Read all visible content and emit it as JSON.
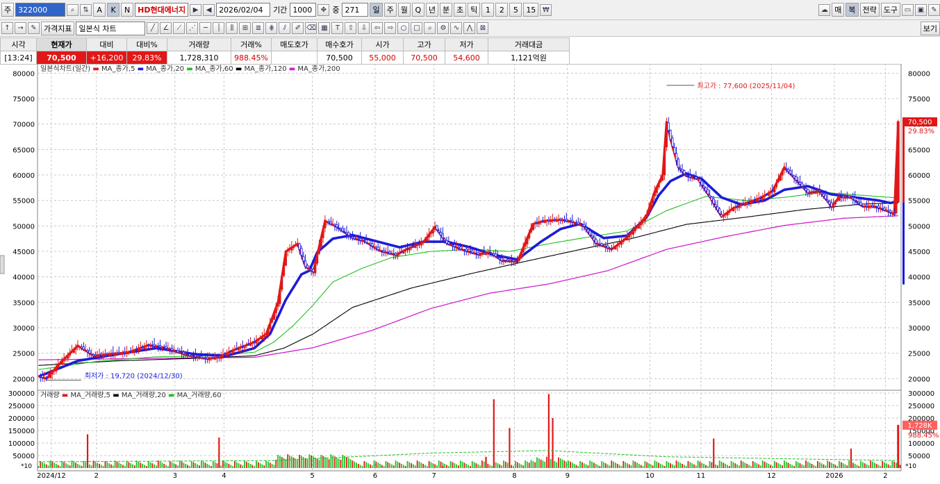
{
  "toolbar": {
    "code_prefix": "주",
    "code": "322000",
    "btn_a": "A",
    "btn_k": "K",
    "btn_n": "N",
    "stock_name": "HD현대에너지",
    "date": "2026/02/04",
    "period_label": "기간",
    "period_value": "1000",
    "jung_label": "중",
    "jung_value": "271",
    "periods": [
      "일",
      "주",
      "월",
      "Q",
      "년",
      "분",
      "초",
      "틱",
      "1",
      "2",
      "5",
      "15"
    ],
    "right_btns": [
      "매",
      "복",
      "전략",
      "도구"
    ]
  },
  "toolbar2": {
    "indicator_btn": "가격지표",
    "chart_type": "일본식 차트",
    "view_btn": "보기"
  },
  "quote": {
    "headers": [
      "시각",
      "현재가",
      "대비",
      "대비%",
      "거래량",
      "거래%",
      "매도호가",
      "매수호가",
      "시가",
      "고가",
      "저가",
      "거래대금"
    ],
    "values": [
      "[13:24]",
      "70,500",
      "+16,200",
      "29.83%",
      "1,728,310",
      "988.45%",
      "",
      "70,500",
      "55,000",
      "70,500",
      "54,600",
      "1,121억원"
    ]
  },
  "colors": {
    "candle_up": "#e01818",
    "candle_down": "#1818e0",
    "ma5": "#e01818",
    "ma20": "#1c1cd8",
    "ma60": "#20c020",
    "ma120": "#000000",
    "ma200": "#d020d0"
  },
  "chart_data": [
    {
      "type": "candlestick",
      "legend": "일본식차트(일간)",
      "legend_items": [
        "MA_종가,5",
        "MA_종가,20",
        "MA_종가,60",
        "MA_종가,120",
        "MA_종가,200"
      ],
      "ylim": [
        18000,
        81000
      ],
      "yticks": [
        20000,
        25000,
        30000,
        35000,
        40000,
        45000,
        50000,
        55000,
        60000,
        65000,
        70000,
        75000,
        80000
      ],
      "x_labels": [
        "2024/12",
        "2",
        "3",
        "4",
        "5",
        "6",
        "7",
        "8",
        "9",
        "10",
        "11",
        "12",
        "2026",
        "2"
      ],
      "close_series": [
        [
          0,
          20500
        ],
        [
          4,
          20000
        ],
        [
          12,
          23500
        ],
        [
          20,
          26500
        ],
        [
          28,
          24500
        ],
        [
          36,
          24800
        ],
        [
          46,
          25200
        ],
        [
          56,
          26600
        ],
        [
          64,
          26100
        ],
        [
          76,
          24600
        ],
        [
          86,
          23900
        ],
        [
          92,
          24200
        ],
        [
          98,
          25400
        ],
        [
          110,
          27200
        ],
        [
          116,
          28800
        ],
        [
          122,
          35000
        ],
        [
          126,
          45000
        ],
        [
          132,
          46500
        ],
        [
          136,
          42000
        ],
        [
          140,
          41000
        ],
        [
          146,
          51000
        ],
        [
          152,
          49800
        ],
        [
          160,
          47600
        ],
        [
          166,
          47000
        ],
        [
          174,
          45100
        ],
        [
          182,
          44300
        ],
        [
          188,
          45500
        ],
        [
          196,
          46800
        ],
        [
          202,
          49800
        ],
        [
          208,
          46600
        ],
        [
          216,
          45300
        ],
        [
          224,
          44400
        ],
        [
          230,
          44800
        ],
        [
          236,
          43200
        ],
        [
          244,
          43000
        ],
        [
          252,
          50400
        ],
        [
          258,
          51000
        ],
        [
          266,
          51200
        ],
        [
          272,
          50800
        ],
        [
          278,
          49900
        ],
        [
          284,
          46600
        ],
        [
          292,
          45400
        ],
        [
          300,
          47800
        ],
        [
          306,
          50200
        ],
        [
          310,
          52200
        ],
        [
          314,
          56800
        ],
        [
          318,
          60000
        ],
        [
          320,
          70500
        ],
        [
          322,
          67000
        ],
        [
          326,
          61500
        ],
        [
          330,
          59800
        ],
        [
          336,
          59200
        ],
        [
          342,
          55700
        ],
        [
          348,
          51800
        ],
        [
          354,
          53500
        ],
        [
          360,
          54400
        ],
        [
          368,
          55500
        ],
        [
          374,
          56900
        ],
        [
          380,
          61500
        ],
        [
          386,
          59000
        ],
        [
          392,
          56500
        ],
        [
          398,
          56800
        ],
        [
          404,
          53800
        ],
        [
          408,
          55700
        ],
        [
          414,
          55600
        ],
        [
          420,
          53800
        ],
        [
          426,
          53800
        ],
        [
          432,
          53000
        ],
        [
          436,
          52300
        ],
        [
          438,
          70500
        ]
      ],
      "ma20_series": [
        [
          0,
          20400
        ],
        [
          20,
          23500
        ],
        [
          40,
          24800
        ],
        [
          60,
          26000
        ],
        [
          80,
          24800
        ],
        [
          96,
          24500
        ],
        [
          110,
          26000
        ],
        [
          118,
          28800
        ],
        [
          126,
          35500
        ],
        [
          134,
          40500
        ],
        [
          138,
          41200
        ],
        [
          142,
          44800
        ],
        [
          150,
          47500
        ],
        [
          160,
          48200
        ],
        [
          172,
          47000
        ],
        [
          184,
          45800
        ],
        [
          196,
          46900
        ],
        [
          208,
          46900
        ],
        [
          220,
          45800
        ],
        [
          232,
          44300
        ],
        [
          244,
          43400
        ],
        [
          256,
          46900
        ],
        [
          266,
          49400
        ],
        [
          276,
          50400
        ],
        [
          288,
          47600
        ],
        [
          300,
          48100
        ],
        [
          310,
          51800
        ],
        [
          316,
          56000
        ],
        [
          322,
          58800
        ],
        [
          330,
          60300
        ],
        [
          338,
          59200
        ],
        [
          348,
          55600
        ],
        [
          358,
          54200
        ],
        [
          370,
          55000
        ],
        [
          380,
          57100
        ],
        [
          392,
          57800
        ],
        [
          404,
          56200
        ],
        [
          416,
          55600
        ],
        [
          428,
          55000
        ],
        [
          434,
          54500
        ],
        [
          438,
          54800
        ]
      ],
      "ma60_series": [
        [
          0,
          21800
        ],
        [
          30,
          23400
        ],
        [
          60,
          24300
        ],
        [
          90,
          24500
        ],
        [
          110,
          25200
        ],
        [
          120,
          27200
        ],
        [
          130,
          30500
        ],
        [
          140,
          34500
        ],
        [
          150,
          39000
        ],
        [
          165,
          41700
        ],
        [
          180,
          43800
        ],
        [
          200,
          45000
        ],
        [
          220,
          45400
        ],
        [
          240,
          45000
        ],
        [
          260,
          46500
        ],
        [
          280,
          47800
        ],
        [
          300,
          49000
        ],
        [
          320,
          53000
        ],
        [
          340,
          55800
        ],
        [
          360,
          55000
        ],
        [
          380,
          55600
        ],
        [
          400,
          56600
        ],
        [
          420,
          56000
        ],
        [
          438,
          55500
        ]
      ],
      "ma120_series": [
        [
          0,
          22600
        ],
        [
          40,
          23500
        ],
        [
          80,
          24000
        ],
        [
          110,
          24500
        ],
        [
          125,
          26000
        ],
        [
          140,
          28800
        ],
        [
          160,
          34000
        ],
        [
          190,
          37800
        ],
        [
          220,
          40600
        ],
        [
          250,
          43200
        ],
        [
          280,
          45700
        ],
        [
          300,
          47300
        ],
        [
          330,
          50300
        ],
        [
          360,
          51700
        ],
        [
          390,
          53200
        ],
        [
          420,
          54300
        ],
        [
          438,
          54500
        ]
      ],
      "ma200_series": [
        [
          0,
          23700
        ],
        [
          60,
          24000
        ],
        [
          110,
          24200
        ],
        [
          140,
          26100
        ],
        [
          170,
          29500
        ],
        [
          200,
          33800
        ],
        [
          230,
          36800
        ],
        [
          260,
          38600
        ],
        [
          290,
          41200
        ],
        [
          320,
          45400
        ],
        [
          350,
          47900
        ],
        [
          380,
          50100
        ],
        [
          410,
          51500
        ],
        [
          438,
          52000
        ]
      ],
      "annotations": {
        "high": "최고가 : 77,600 (2025/11/04)",
        "low": "최저가 : 19,720 (2024/12/30)"
      },
      "last_price_label": "70,500",
      "last_pct_label": "29.83%"
    },
    {
      "type": "bar",
      "legend": "거래량",
      "legend_items": [
        "MA_거래량,5",
        "MA_거래량,20",
        "MA_거래량,60"
      ],
      "ylim": [
        0,
        300000
      ],
      "yticks": [
        50000,
        100000,
        150000,
        200000,
        250000,
        300000
      ],
      "axis_unit": "10",
      "spikes": [
        [
          25,
          135000
        ],
        [
          92,
          122000
        ],
        [
          206,
          8000
        ],
        [
          228,
          45000
        ],
        [
          232,
          275000
        ],
        [
          240,
          160000
        ],
        [
          260,
          296000
        ],
        [
          262,
          200000
        ],
        [
          344,
          118000
        ],
        [
          414,
          78000
        ],
        [
          494,
          16000
        ],
        [
          543,
          14000
        ]
      ],
      "ma60_levels": [
        [
          0,
          25000
        ],
        [
          120,
          30000
        ],
        [
          200,
          60000
        ],
        [
          260,
          70000
        ],
        [
          320,
          45000
        ],
        [
          438,
          30000
        ]
      ],
      "last_volume_label": "1,728K",
      "last_pct_label": "988.45%"
    }
  ]
}
